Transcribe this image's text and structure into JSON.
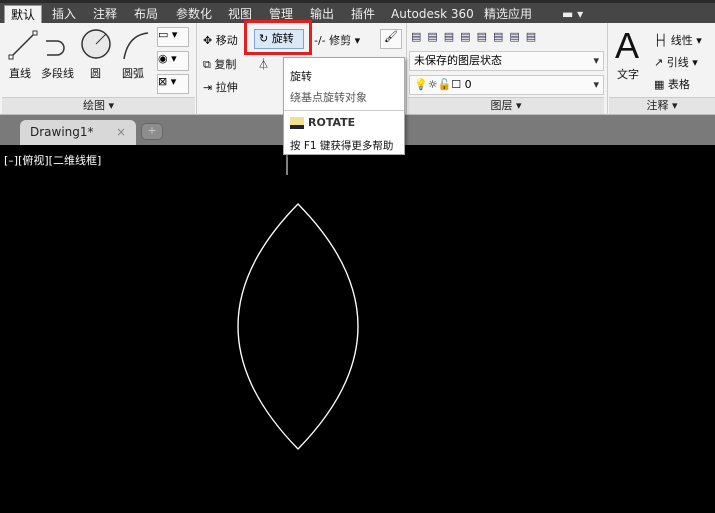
{
  "ribbon_tabs": [
    "默认",
    "插入",
    "注释",
    "布局",
    "参数化",
    "视图",
    "管理",
    "输出",
    "插件",
    "Autodesk 360",
    "精选应用"
  ],
  "draw": {
    "line": "直线",
    "polyline": "多段线",
    "circle": "圆",
    "arc": "圆弧",
    "panel": "绘图"
  },
  "modify": {
    "move": "移动",
    "rotate": "旋转",
    "trim": "修剪",
    "copy": "复制",
    "stretch": "拉伸"
  },
  "layers": {
    "state": "未保存的图层状态",
    "current": "0",
    "panel": "图层"
  },
  "annotation": {
    "text": "文字",
    "linear": "线性",
    "leader": "引线",
    "table": "表格",
    "panel": "注释"
  },
  "tooltip": {
    "title": "旋转",
    "desc": "绕基点旋转对象",
    "command": "ROTATE",
    "help": "按 F1 键获得更多帮助"
  },
  "document_tab": {
    "name": "Drawing1*",
    "close": "×"
  },
  "viewport_label": "[–][俯视][二维线框]",
  "highlight_color": "#e02020"
}
